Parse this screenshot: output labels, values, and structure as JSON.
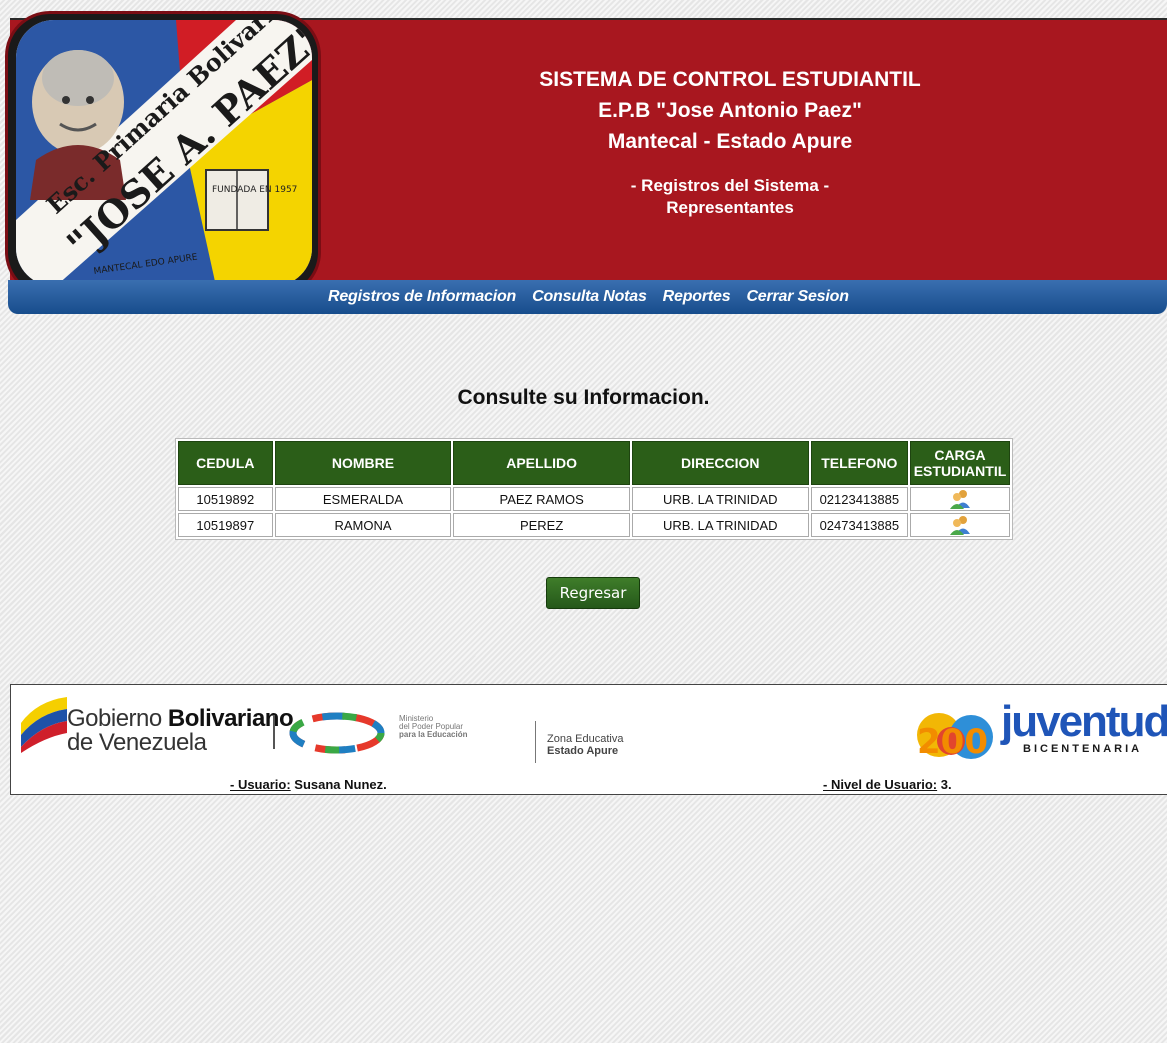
{
  "header": {
    "logo_text": [
      "Esc. Primaria Bolivariana",
      "\"JOSE A. PAEZ\"",
      "FUNDADA EN 1957",
      "MANTECAL EDO APURE"
    ],
    "title_lines": [
      "SISTEMA DE CONTROL ESTUDIANTIL",
      "E.P.B \"Jose Antonio Paez\"",
      "Mantecal - Estado Apure"
    ],
    "subtitle_lines": [
      "- Registros del Sistema -",
      "Representantes"
    ]
  },
  "nav": {
    "items": [
      "Registros de Informacion",
      "Consulta Notas",
      "Reportes",
      "Cerrar Sesion"
    ]
  },
  "main": {
    "title": "Consulte su Informacion.",
    "table": {
      "headers": [
        "CEDULA",
        "NOMBRE",
        "APELLIDO",
        "DIRECCION",
        "TELEFONO",
        "CARGA ESTUDIANTIL"
      ],
      "rows": [
        {
          "cedula": "10519892",
          "nombre": "ESMERALDA",
          "apellido": "PAEZ RAMOS",
          "direccion": "URB. LA TRINIDAD",
          "telefono": "02123413885",
          "carga_icon": "users-icon"
        },
        {
          "cedula": "10519897",
          "nombre": "RAMONA",
          "apellido": "PEREZ",
          "direccion": "URB. LA TRINIDAD",
          "telefono": "02473413885",
          "carga_icon": "users-icon"
        }
      ]
    },
    "back_button": "Regresar"
  },
  "footer": {
    "gobierno": {
      "line1_light": "Gobierno ",
      "line1_bold": "Bolivariano",
      "line2": "de Venezuela"
    },
    "ministerio": [
      "Ministerio",
      "del Poder Popular",
      "para la Educación"
    ],
    "zona": [
      "Zona Educativa",
      "Estado Apure"
    ],
    "juventud": {
      "word": "juventud",
      "sub": "BICENTENARIA",
      "num": "200"
    },
    "usuario_label": "- Usuario:",
    "usuario_value": " Susana Nunez.",
    "nivel_label": "- Nivel de Usuario:",
    "nivel_value": " 3."
  },
  "colors": {
    "header_red": "#a8171f",
    "nav_blue": "#174d8c",
    "table_header_green": "#2b5e18",
    "button_green": "#2f6a1f"
  }
}
